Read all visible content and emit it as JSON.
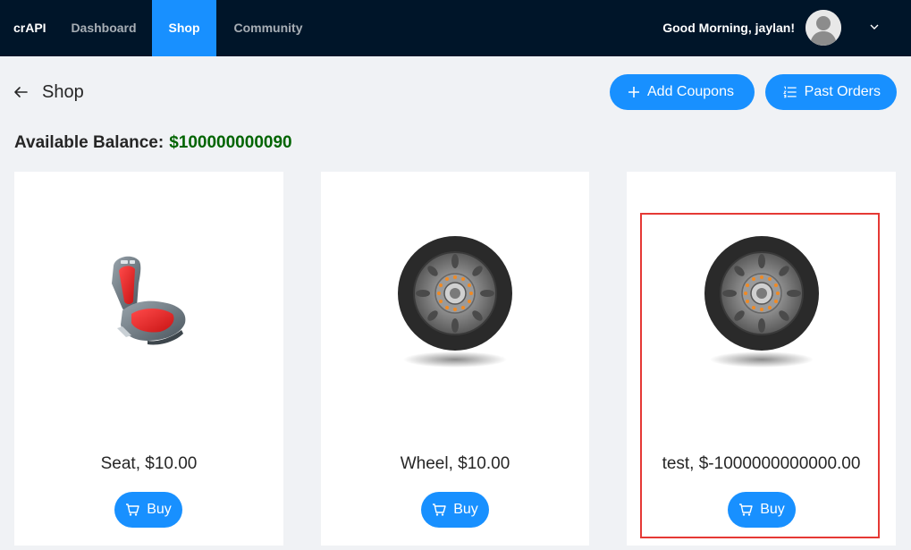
{
  "header": {
    "brand": "crAPI",
    "nav": [
      {
        "label": "Dashboard"
      },
      {
        "label": "Shop"
      },
      {
        "label": "Community"
      }
    ],
    "greeting": "Good Morning, jaylan!"
  },
  "page": {
    "title": "Shop",
    "add_coupons_label": "Add Coupons",
    "past_orders_label": "Past Orders",
    "balance_label": "Available Balance:",
    "balance_value": "$100000000090"
  },
  "products": [
    {
      "name": "Seat, $10.00",
      "buy_label": "Buy",
      "image": "car-seat"
    },
    {
      "name": "Wheel, $10.00",
      "buy_label": "Buy",
      "image": "wheel"
    },
    {
      "name": "test, $-1000000000000.00",
      "buy_label": "Buy",
      "image": "wheel"
    }
  ],
  "colors": {
    "header_bg": "#001529",
    "accent": "#1890ff",
    "balance": "#006400",
    "highlight": "#e53935"
  }
}
